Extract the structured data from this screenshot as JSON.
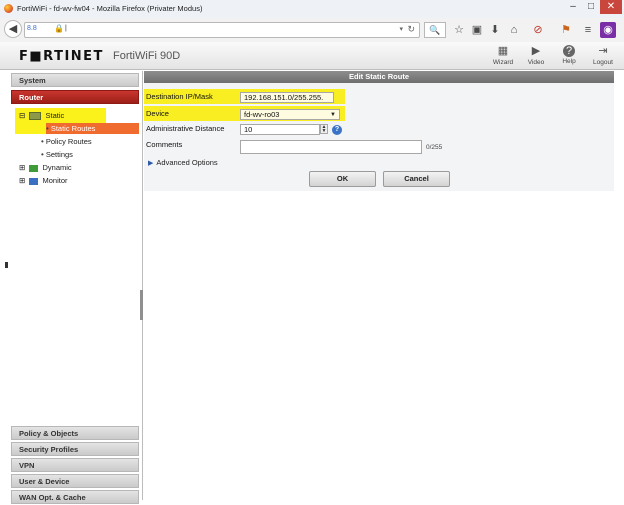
{
  "browser": {
    "window_title": "FortiWiFi - fd-wv-fw04 - Mozilla Firefox (Privater Modus)",
    "window_controls": {
      "minimize": "–",
      "maximize": "□",
      "close": "✕"
    },
    "back_glyph": "◀",
    "url": {
      "site_badge": "8.8",
      "lock_glyph": "🔒",
      "text": "|",
      "reload_glyph": "↻",
      "dropdown_glyph": "▾"
    },
    "search_glyph": "🔍",
    "toolbar_icons": [
      "star-icon",
      "clipboard-icon",
      "download-icon",
      "home-icon",
      "adblock-icon",
      "extension-icon",
      "menu-icon",
      "private-mask-icon"
    ],
    "toolbar_glyphs": [
      "☆",
      "▣",
      "⬇",
      "⌂",
      "⊘",
      "⚑",
      "≡",
      "◉"
    ]
  },
  "header": {
    "logo": "F■RTINET",
    "model": "FortiWiFi 90D",
    "buttons": [
      {
        "label": "Wizard",
        "icon": "wizard-icon",
        "glyph": "▦"
      },
      {
        "label": "Video",
        "icon": "video-icon",
        "glyph": "▶"
      },
      {
        "label": "Help",
        "icon": "help-icon",
        "glyph": "?"
      },
      {
        "label": "Logout",
        "icon": "logout-icon",
        "glyph": "⇥"
      }
    ]
  },
  "sidebar": {
    "sections_top": [
      "System",
      "Router"
    ],
    "tree": {
      "static": "Static",
      "static_routes": "Static Routes",
      "policy_routes": "Policy Routes",
      "settings": "Settings",
      "dynamic": "Dynamic",
      "monitor": "Monitor",
      "expand_glyph": "⊟",
      "collapse_glyph": "⊞",
      "bullet": "•"
    },
    "sections_bottom": [
      "Policy & Objects",
      "Security Profiles",
      "VPN",
      "User & Device",
      "WAN Opt. & Cache"
    ]
  },
  "panel": {
    "title": "Edit Static Route",
    "fields": {
      "destination": {
        "label": "Destination IP/Mask",
        "value": "192.168.151.0/255.255."
      },
      "device": {
        "label": "Device",
        "value": "fd-wv-ro03",
        "arrow": "▼"
      },
      "distance": {
        "label": "Administrative Distance",
        "value": "10",
        "help": "?"
      },
      "comments": {
        "label": "Comments",
        "value": "",
        "counter": "0/255"
      }
    },
    "advanced": {
      "label": "Advanced Options",
      "glyph": "▶"
    },
    "buttons": {
      "ok": "OK",
      "cancel": "Cancel"
    }
  },
  "colors": {
    "router_section": "#b52a22",
    "selected_item": "#ef6b2e",
    "highlight": "#f8ee22",
    "panel_title": "#7a7a7a"
  }
}
